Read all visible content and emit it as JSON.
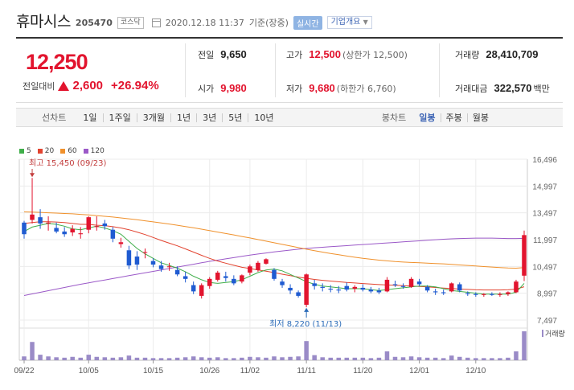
{
  "header": {
    "name": "휴마시스",
    "code": "205470",
    "market": "코스닥",
    "datetime": "2020.12.18 11:37",
    "basis": "기준(장중)",
    "realtime_label": "실시간",
    "company_info_label": "기업개요"
  },
  "price": {
    "current": "12,250",
    "change_label": "전일대비",
    "change": "2,600",
    "change_pct": "+26.94%"
  },
  "stats": {
    "prev_close": {
      "label": "전일",
      "value": "9,650"
    },
    "open": {
      "label": "시가",
      "value": "9,980"
    },
    "high": {
      "label": "고가",
      "value": "12,500",
      "sub": "(상한가 12,500)"
    },
    "low": {
      "label": "저가",
      "value": "9,680",
      "sub": "(하한가 6,760)"
    },
    "volume": {
      "label": "거래량",
      "value": "28,410,709"
    },
    "amount": {
      "label": "거래대금",
      "value": "322,570",
      "unit": "백만"
    }
  },
  "toolbar": {
    "line_label": "선차트",
    "line_periods": [
      "1일",
      "1주일",
      "3개월",
      "1년",
      "3년",
      "5년",
      "10년"
    ],
    "candle_label": "봉차트",
    "candle_periods": [
      "일봉",
      "주봉",
      "월봉"
    ],
    "active_candle": "일봉"
  },
  "legend": [
    {
      "label": "5",
      "color": "#3fae49"
    },
    {
      "label": "20",
      "color": "#e2432f"
    },
    {
      "label": "60",
      "color": "#f0912c"
    },
    {
      "label": "120",
      "color": "#9b59c8"
    }
  ],
  "chart_data": {
    "type": "candlestick",
    "y_ticks": [
      16496,
      14997,
      13497,
      11997,
      10497,
      8997,
      7497
    ],
    "y_tick_labels": [
      "16,496",
      "14,997",
      "13,497",
      "11,997",
      "10,497",
      "8,997",
      "7,497"
    ],
    "ylim": [
      7497,
      16496
    ],
    "x_tick_labels": [
      {
        "label": "09/22",
        "index": 0
      },
      {
        "label": "10/05",
        "index": 8
      },
      {
        "label": "10/15",
        "index": 16
      },
      {
        "label": "10/26",
        "index": 23
      },
      {
        "label": "11/02",
        "index": 28
      },
      {
        "label": "11/11",
        "index": 35
      },
      {
        "label": "11/20",
        "index": 42
      },
      {
        "label": "12/01",
        "index": 49
      },
      {
        "label": "12/10",
        "index": 56
      }
    ],
    "high_annotation": "최고 15,450 (09/23)",
    "low_annotation": "최저 8,220 (11/13)",
    "volume_label": "거래량",
    "candles": [
      [
        12950,
        13050,
        12050,
        12300
      ],
      [
        13100,
        15450,
        12900,
        13400
      ],
      [
        13250,
        13700,
        12600,
        12900
      ],
      [
        12900,
        13300,
        12500,
        12950
      ],
      [
        12650,
        12950,
        12350,
        12450
      ],
      [
        12450,
        12700,
        12150,
        12300
      ],
      [
        12400,
        12800,
        12200,
        12600
      ],
      [
        12300,
        12700,
        12050,
        12350
      ],
      [
        12550,
        13300,
        12350,
        13250
      ],
      [
        12700,
        13300,
        12500,
        12750
      ],
      [
        12900,
        13100,
        12550,
        12750
      ],
      [
        12550,
        12700,
        11850,
        12050
      ],
      [
        11750,
        12100,
        11550,
        11850
      ],
      [
        11400,
        11650,
        10350,
        10550
      ],
      [
        11050,
        11350,
        10300,
        10600
      ],
      [
        11300,
        11500,
        10950,
        11300
      ],
      [
        10800,
        10950,
        10450,
        10600
      ],
      [
        10550,
        10800,
        10200,
        10350
      ],
      [
        10500,
        10700,
        10250,
        10500
      ],
      [
        10300,
        10500,
        9950,
        10050
      ],
      [
        9950,
        10200,
        9600,
        9800
      ],
      [
        9450,
        9650,
        8950,
        9100
      ],
      [
        8850,
        9550,
        8700,
        9450
      ],
      [
        9400,
        9900,
        9250,
        9800
      ],
      [
        9750,
        10250,
        9650,
        10150
      ],
      [
        9950,
        10200,
        9650,
        9850
      ],
      [
        9800,
        10000,
        9450,
        9550
      ],
      [
        9650,
        10050,
        9550,
        10000
      ],
      [
        10150,
        10600,
        10000,
        10500
      ],
      [
        10300,
        10800,
        10200,
        10700
      ],
      [
        10650,
        10950,
        10600,
        10900
      ],
      [
        10300,
        10400,
        9700,
        9800
      ],
      [
        9650,
        9800,
        9300,
        9450
      ],
      [
        9300,
        9500,
        8950,
        9150
      ],
      [
        9050,
        9150,
        8750,
        8850
      ],
      [
        8350,
        10100,
        8220,
        10050
      ],
      [
        9550,
        9750,
        9200,
        9400
      ],
      [
        9350,
        9550,
        9100,
        9300
      ],
      [
        9250,
        9450,
        9050,
        9200
      ],
      [
        9200,
        9400,
        9000,
        9150
      ],
      [
        9400,
        9600,
        9100,
        9200
      ],
      [
        9250,
        9450,
        9050,
        9350
      ],
      [
        9300,
        9500,
        9100,
        9200
      ],
      [
        9200,
        9350,
        9000,
        9100
      ],
      [
        9150,
        9300,
        8950,
        9050
      ],
      [
        9100,
        9900,
        9050,
        9750
      ],
      [
        9500,
        9700,
        9350,
        9450
      ],
      [
        9400,
        9550,
        9250,
        9350
      ],
      [
        9350,
        9900,
        9300,
        9800
      ],
      [
        9650,
        9800,
        9400,
        9500
      ],
      [
        9350,
        9450,
        9050,
        9150
      ],
      [
        9100,
        9250,
        8900,
        9050
      ],
      [
        9050,
        9200,
        8900,
        9000
      ],
      [
        9100,
        9600,
        9050,
        9550
      ],
      [
        9500,
        9600,
        9050,
        9150
      ],
      [
        9000,
        9100,
        8850,
        8950
      ],
      [
        8950,
        9050,
        8800,
        8900
      ],
      [
        8900,
        9000,
        8800,
        8950
      ],
      [
        8950,
        9050,
        8850,
        8900
      ],
      [
        8900,
        9050,
        8800,
        8950
      ],
      [
        8950,
        9100,
        8850,
        9050
      ],
      [
        9050,
        9750,
        9000,
        9650
      ],
      [
        9980,
        12500,
        9680,
        12250
      ]
    ],
    "volumes": [
      9,
      43,
      13,
      9,
      7,
      6,
      8,
      6,
      13,
      8,
      7,
      6,
      7,
      11,
      6,
      6,
      5,
      5,
      5,
      6,
      7,
      9,
      7,
      6,
      7,
      5,
      5,
      6,
      8,
      7,
      6,
      9,
      7,
      8,
      9,
      45,
      12,
      7,
      6,
      6,
      6,
      6,
      6,
      5,
      6,
      21,
      8,
      7,
      9,
      7,
      6,
      6,
      5,
      11,
      8,
      6,
      5,
      5,
      5,
      5,
      6,
      21,
      68
    ],
    "ma5": [
      12450,
      12700,
      12800,
      12900,
      12850,
      12750,
      12600,
      12550,
      12650,
      12750,
      12650,
      12500,
      12300,
      11900,
      11500,
      11200,
      10950,
      10700,
      10550,
      10400,
      10200,
      9950,
      9750,
      9600,
      9550,
      9600,
      9650,
      9750,
      9950,
      10150,
      10300,
      10350,
      10250,
      10050,
      9850,
      9650,
      9500,
      9400,
      9350,
      9300,
      9250,
      9250,
      9250,
      9200,
      9150,
      9200,
      9250,
      9300,
      9350,
      9400,
      9400,
      9350,
      9250,
      9150,
      9100,
      9050,
      9000,
      8950,
      8950,
      8950,
      8950,
      9050,
      9550
    ],
    "ma20": [
      12900,
      12950,
      13000,
      13000,
      12980,
      12950,
      12900,
      12850,
      12850,
      12800,
      12780,
      12720,
      12650,
      12550,
      12420,
      12280,
      12120,
      11950,
      11800,
      11650,
      11480,
      11300,
      11120,
      10950,
      10800,
      10680,
      10560,
      10450,
      10380,
      10300,
      10230,
      10150,
      10060,
      9980,
      9900,
      9830,
      9770,
      9720,
      9680,
      9640,
      9600,
      9570,
      9540,
      9510,
      9480,
      9460,
      9440,
      9420,
      9400,
      9380,
      9350,
      9320,
      9290,
      9260,
      9230,
      9210,
      9190,
      9180,
      9180,
      9180,
      9190,
      9230,
      9360
    ],
    "ma60": [
      13550,
      13540,
      13520,
      13500,
      13480,
      13460,
      13440,
      13410,
      13380,
      13340,
      13300,
      13260,
      13210,
      13160,
      13110,
      13050,
      12990,
      12930,
      12870,
      12800,
      12730,
      12660,
      12580,
      12500,
      12420,
      12340,
      12260,
      12170,
      12090,
      12000,
      11910,
      11820,
      11730,
      11640,
      11550,
      11460,
      11380,
      11300,
      11220,
      11150,
      11080,
      11010,
      10950,
      10900,
      10850,
      10810,
      10770,
      10740,
      10720,
      10700,
      10680,
      10660,
      10640,
      10610,
      10580,
      10550,
      10520,
      10490,
      10460,
      10430,
      10410,
      10400,
      10430
    ],
    "ma120": [
      8870,
      8960,
      9050,
      9140,
      9230,
      9320,
      9410,
      9500,
      9580,
      9660,
      9740,
      9820,
      9900,
      9980,
      10060,
      10140,
      10220,
      10300,
      10380,
      10460,
      10540,
      10620,
      10700,
      10780,
      10850,
      10920,
      10990,
      11060,
      11130,
      11190,
      11250,
      11310,
      11360,
      11410,
      11460,
      11500,
      11540,
      11570,
      11600,
      11630,
      11660,
      11690,
      11720,
      11750,
      11780,
      11810,
      11840,
      11870,
      11900,
      11930,
      11960,
      11990,
      12020,
      12040,
      12060,
      12070,
      12080,
      12080,
      12080,
      12070,
      12060,
      12060,
      12070
    ]
  }
}
